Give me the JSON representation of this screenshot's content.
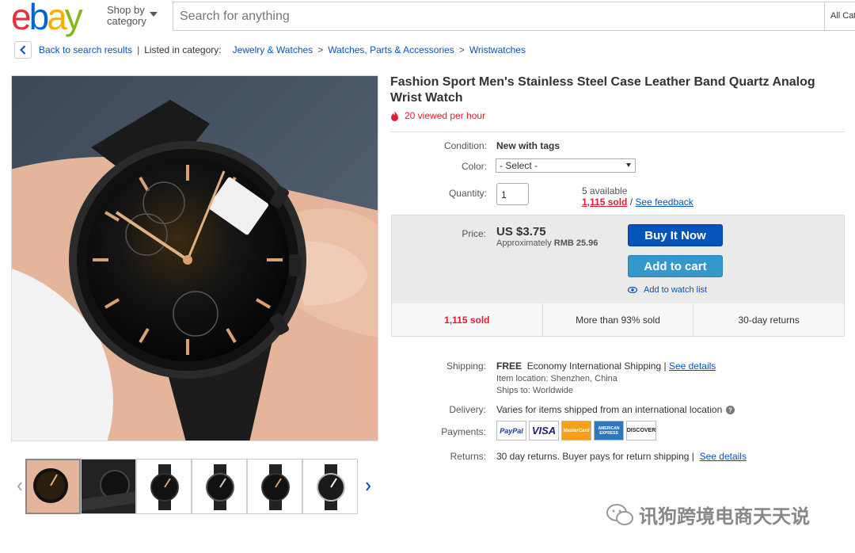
{
  "header": {
    "logo": {
      "e": "e",
      "b": "b",
      "a": "a",
      "y": "y"
    },
    "shop_by_line1": "Shop by",
    "shop_by_line2": "category",
    "search_placeholder": "Search for anything",
    "all_categories": "All Cat"
  },
  "breadcrumb": {
    "back_link": "Back to search results",
    "separator": "|",
    "listed_label": "Listed in category:",
    "items": [
      "Jewelry & Watches",
      "Watches, Parts & Accessories",
      "Wristwatches"
    ],
    "arrow": ">"
  },
  "product": {
    "title": "Fashion Sport Men's Stainless Steel Case Leather Band Quartz Analog Wrist Watch",
    "viewed": "20 viewed per hour",
    "condition_label": "Condition:",
    "condition_value": "New with tags",
    "color_label": "Color:",
    "color_select": "- Select -",
    "quantity_label": "Quantity:",
    "quantity_value": "1",
    "available": "5 available",
    "sold_link": "1,115 sold",
    "feedback_sep": "/",
    "feedback_link": "See feedback",
    "price_label": "Price:",
    "price": "US $3.75",
    "approx_prefix": "Approximately",
    "approx_value": "RMB 25.96",
    "buy_now": "Buy It Now",
    "add_to_cart": "Add to cart",
    "watch_list": "Add to watch list",
    "stats": [
      "1,115 sold",
      "More than 93% sold",
      "30-day returns"
    ]
  },
  "shipping": {
    "shipping_label": "Shipping:",
    "free": "FREE",
    "method": "Economy International Shipping |",
    "details_link": "See details",
    "location": "Item location:  Shenzhen, China",
    "ships_to": "Ships to:  Worldwide",
    "delivery_label": "Delivery:",
    "delivery_value": "Varies for items shipped from an international location",
    "payments_label": "Payments:",
    "payment_cards": [
      "PayPal",
      "VISA",
      "MasterCard",
      "AMERICAN EXPRESS",
      "DISCOVER"
    ],
    "returns_label": "Returns:",
    "returns_value": "30 day returns. Buyer pays for return shipping |",
    "returns_link": "See details"
  },
  "watermark": "讯狗跨境电商天天说",
  "colors": {
    "accent": "#0654ba",
    "red": "#dd1e31",
    "cart": "#3498ca"
  }
}
